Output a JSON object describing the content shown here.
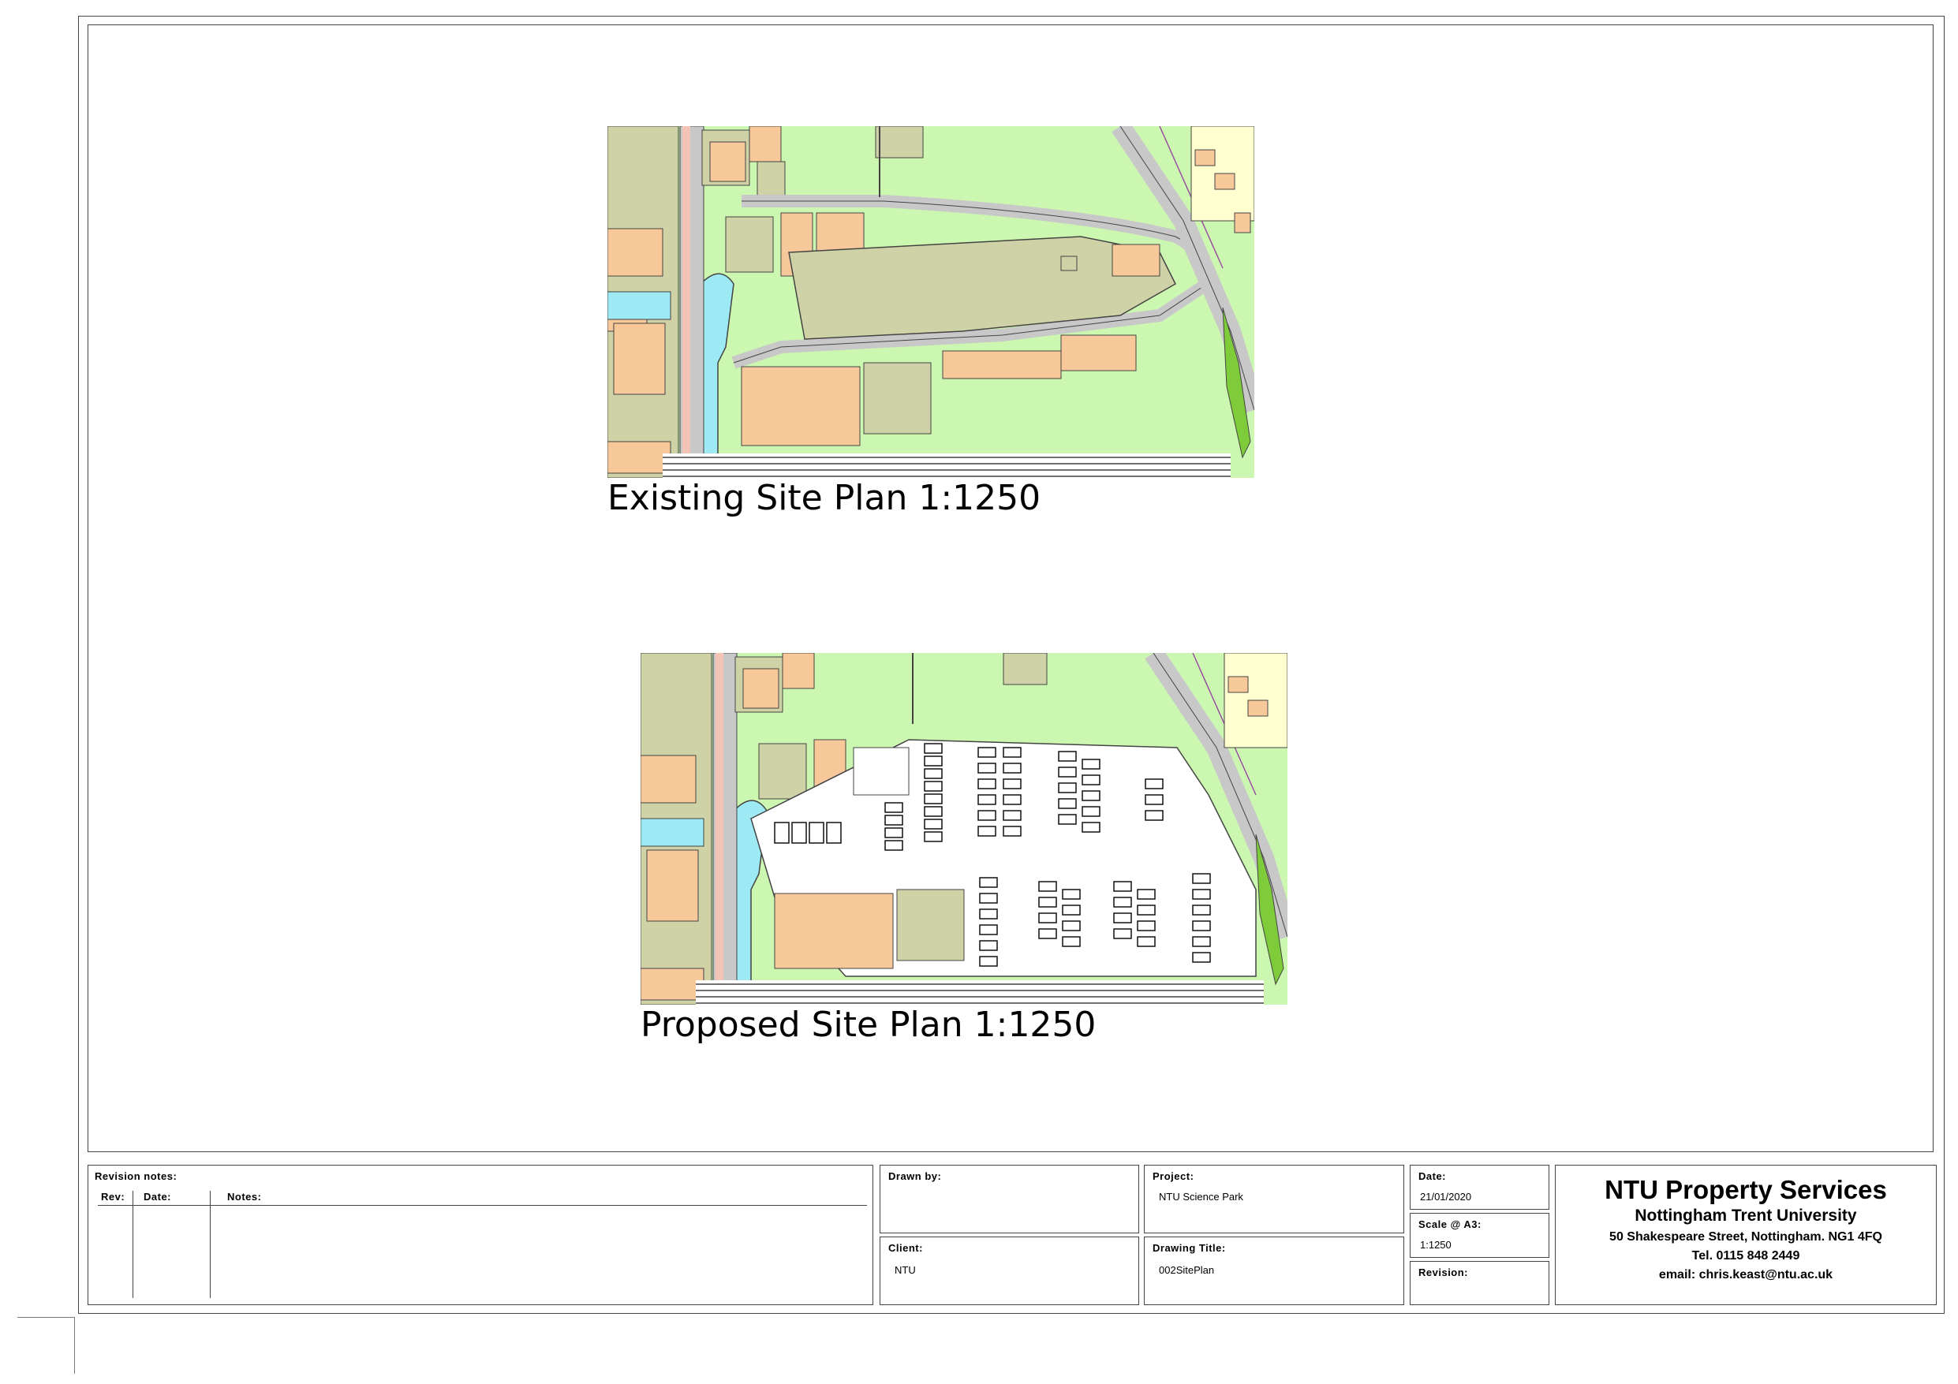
{
  "plans": {
    "existing_title": "Existing Site Plan 1:1250",
    "proposed_title": "Proposed Site Plan 1:1250"
  },
  "title_block": {
    "revision": {
      "heading": "Revision notes:",
      "col_rev": "Rev:",
      "col_date": "Date:",
      "col_notes": "Notes:"
    },
    "drawn_by": {
      "label": "Drawn by:",
      "value": ""
    },
    "client": {
      "label": "Client:",
      "value": "NTU"
    },
    "project": {
      "label": "Project:",
      "value": "NTU Science Park"
    },
    "drawing_title": {
      "label": "Drawing Title:",
      "value": "002SitePlan"
    },
    "date": {
      "label": "Date:",
      "value": "21/01/2020"
    },
    "scale": {
      "label": "Scale @ A3:",
      "value": "1:1250"
    },
    "revision_field": {
      "label": "Revision:",
      "value": ""
    },
    "company": {
      "name": "NTU Property Services",
      "university": "Nottingham Trent University",
      "address": "50 Shakespeare Street, Nottingham. NG1 4FQ",
      "tel": "Tel. 0115 848 2449",
      "email": "email: chris.keast@ntu.ac.uk"
    }
  },
  "colors": {
    "green": "#ccf7b0",
    "building": "#f7c89a",
    "ground": "#cfd2a6",
    "road": "#c8c8c8",
    "water": "#9deaf5",
    "line": "#444444"
  }
}
